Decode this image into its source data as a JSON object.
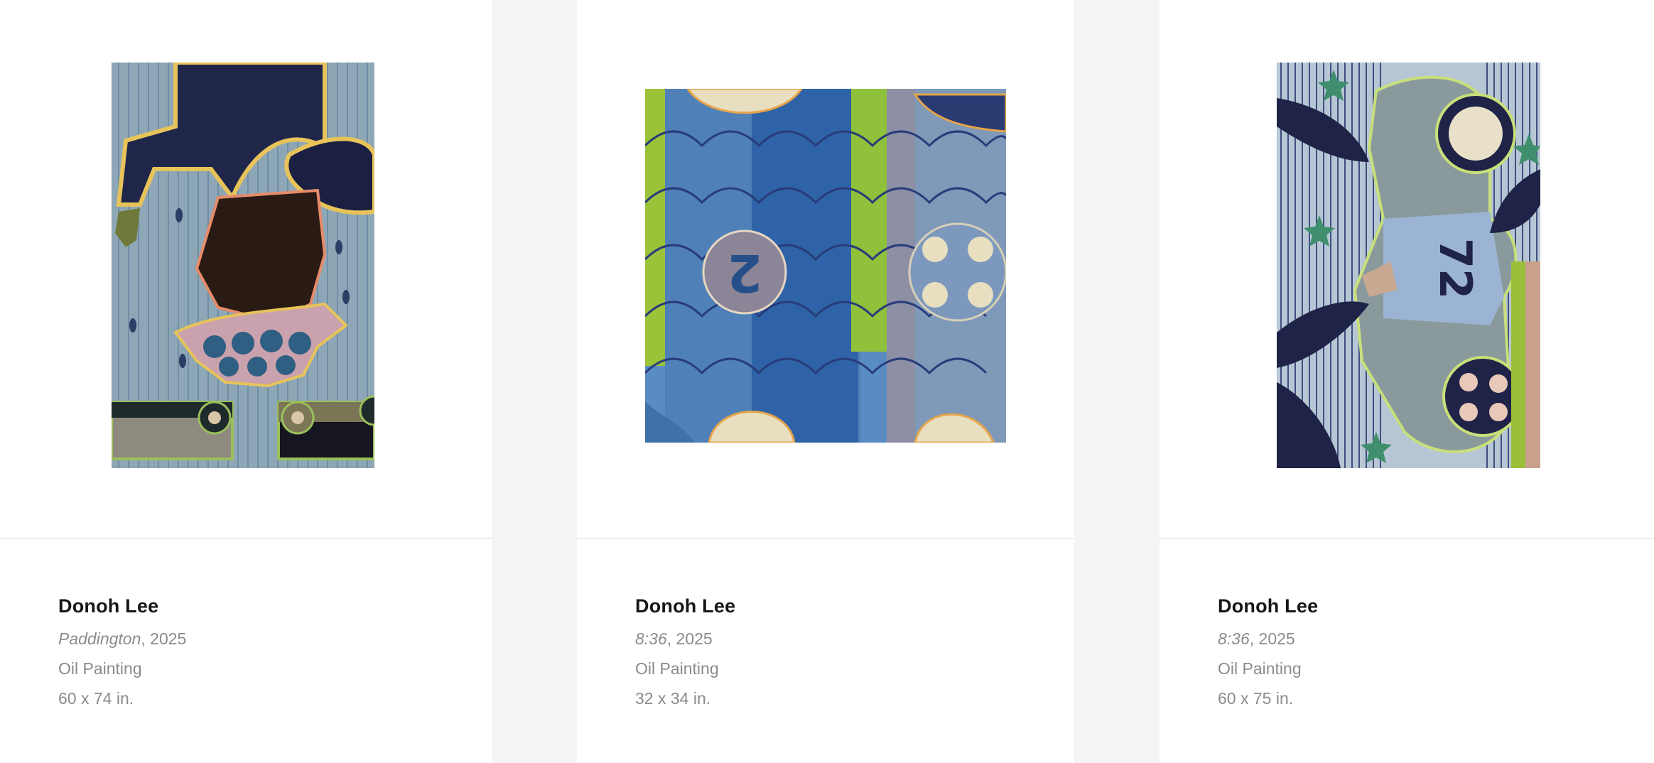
{
  "artworks": [
    {
      "artist": "Donoh Lee",
      "title": "Paddington",
      "year": ", 2025",
      "medium": "Oil Painting",
      "dimensions": "60 x 74 in.",
      "palette": {
        "bg": "#8ea7b6",
        "dark": "#20264a",
        "outline": "#e7c35a",
        "pink": "#c9a2ad"
      }
    },
    {
      "artist": "Donoh Lee",
      "title": "8:36",
      "year": ", 2025",
      "medium": "Oil Painting",
      "dimensions": "32 x 34 in.",
      "palette": {
        "blue": "#4f80b8",
        "light": "#e8dfc0",
        "green": "#9cc23a",
        "grey": "#8d8fa4"
      }
    },
    {
      "artist": "Donoh Lee",
      "title": "8:36",
      "year": ", 2025",
      "medium": "Oil Painting",
      "dimensions": "60 x 75 in.",
      "palette": {
        "bg": "#b7c6d4",
        "navy": "#1f2347",
        "grey": "#8a9a9c",
        "green": "#3f8f6e"
      }
    }
  ]
}
